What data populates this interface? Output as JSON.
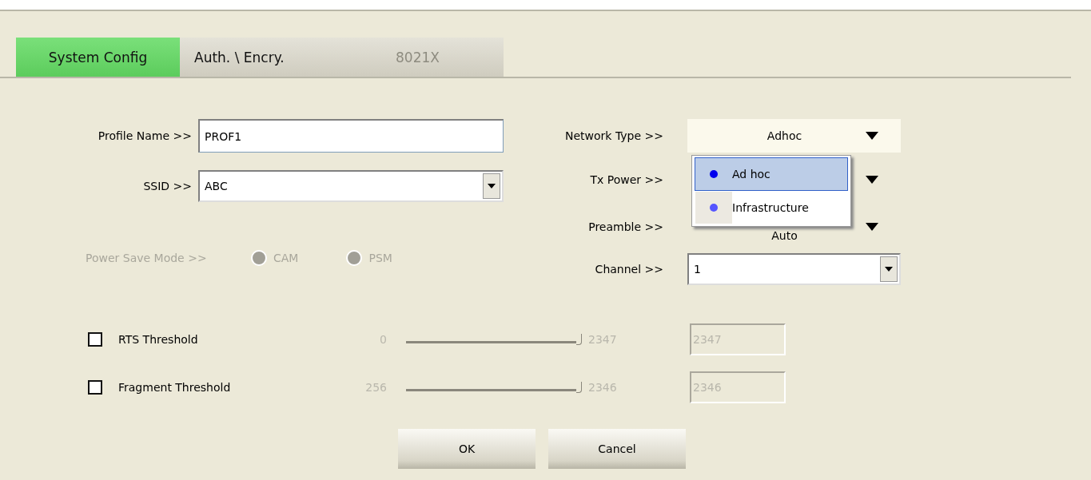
{
  "tabs": [
    {
      "label": "System Config",
      "selected": true,
      "disabled": false
    },
    {
      "label": "Auth. \\ Encry.",
      "selected": false,
      "disabled": false
    },
    {
      "label": "8021X",
      "selected": false,
      "disabled": true
    }
  ],
  "profile_name": {
    "label": "Profile Name >>",
    "value": "PROF1"
  },
  "ssid": {
    "label": "SSID >>",
    "value": "ABC"
  },
  "power_save_mode": {
    "label": "Power Save Mode >>",
    "disabled": true,
    "options": [
      {
        "label": "CAM",
        "selected": false
      },
      {
        "label": "PSM",
        "selected": false
      }
    ]
  },
  "network_type": {
    "label": "Network Type >>",
    "value": "Adhoc",
    "expanded": true,
    "options": [
      {
        "label": "Ad hoc",
        "selected": true
      },
      {
        "label": "Infrastructure",
        "selected": false
      }
    ]
  },
  "tx_power": {
    "label": "Tx Power >>"
  },
  "preamble": {
    "label": "Preamble >>",
    "value": "Auto"
  },
  "channel": {
    "label": "Channel >>",
    "value": "1"
  },
  "thresholds": [
    {
      "label": "RTS Threshold",
      "checked": false,
      "min": "0",
      "max": "2347",
      "level": 1,
      "value": "2347"
    },
    {
      "label": "Fragment Threshold",
      "checked": false,
      "min": "256",
      "max": "2346",
      "level": 1,
      "value": "2346"
    }
  ],
  "buttons": [
    "OK",
    "Cancel"
  ]
}
